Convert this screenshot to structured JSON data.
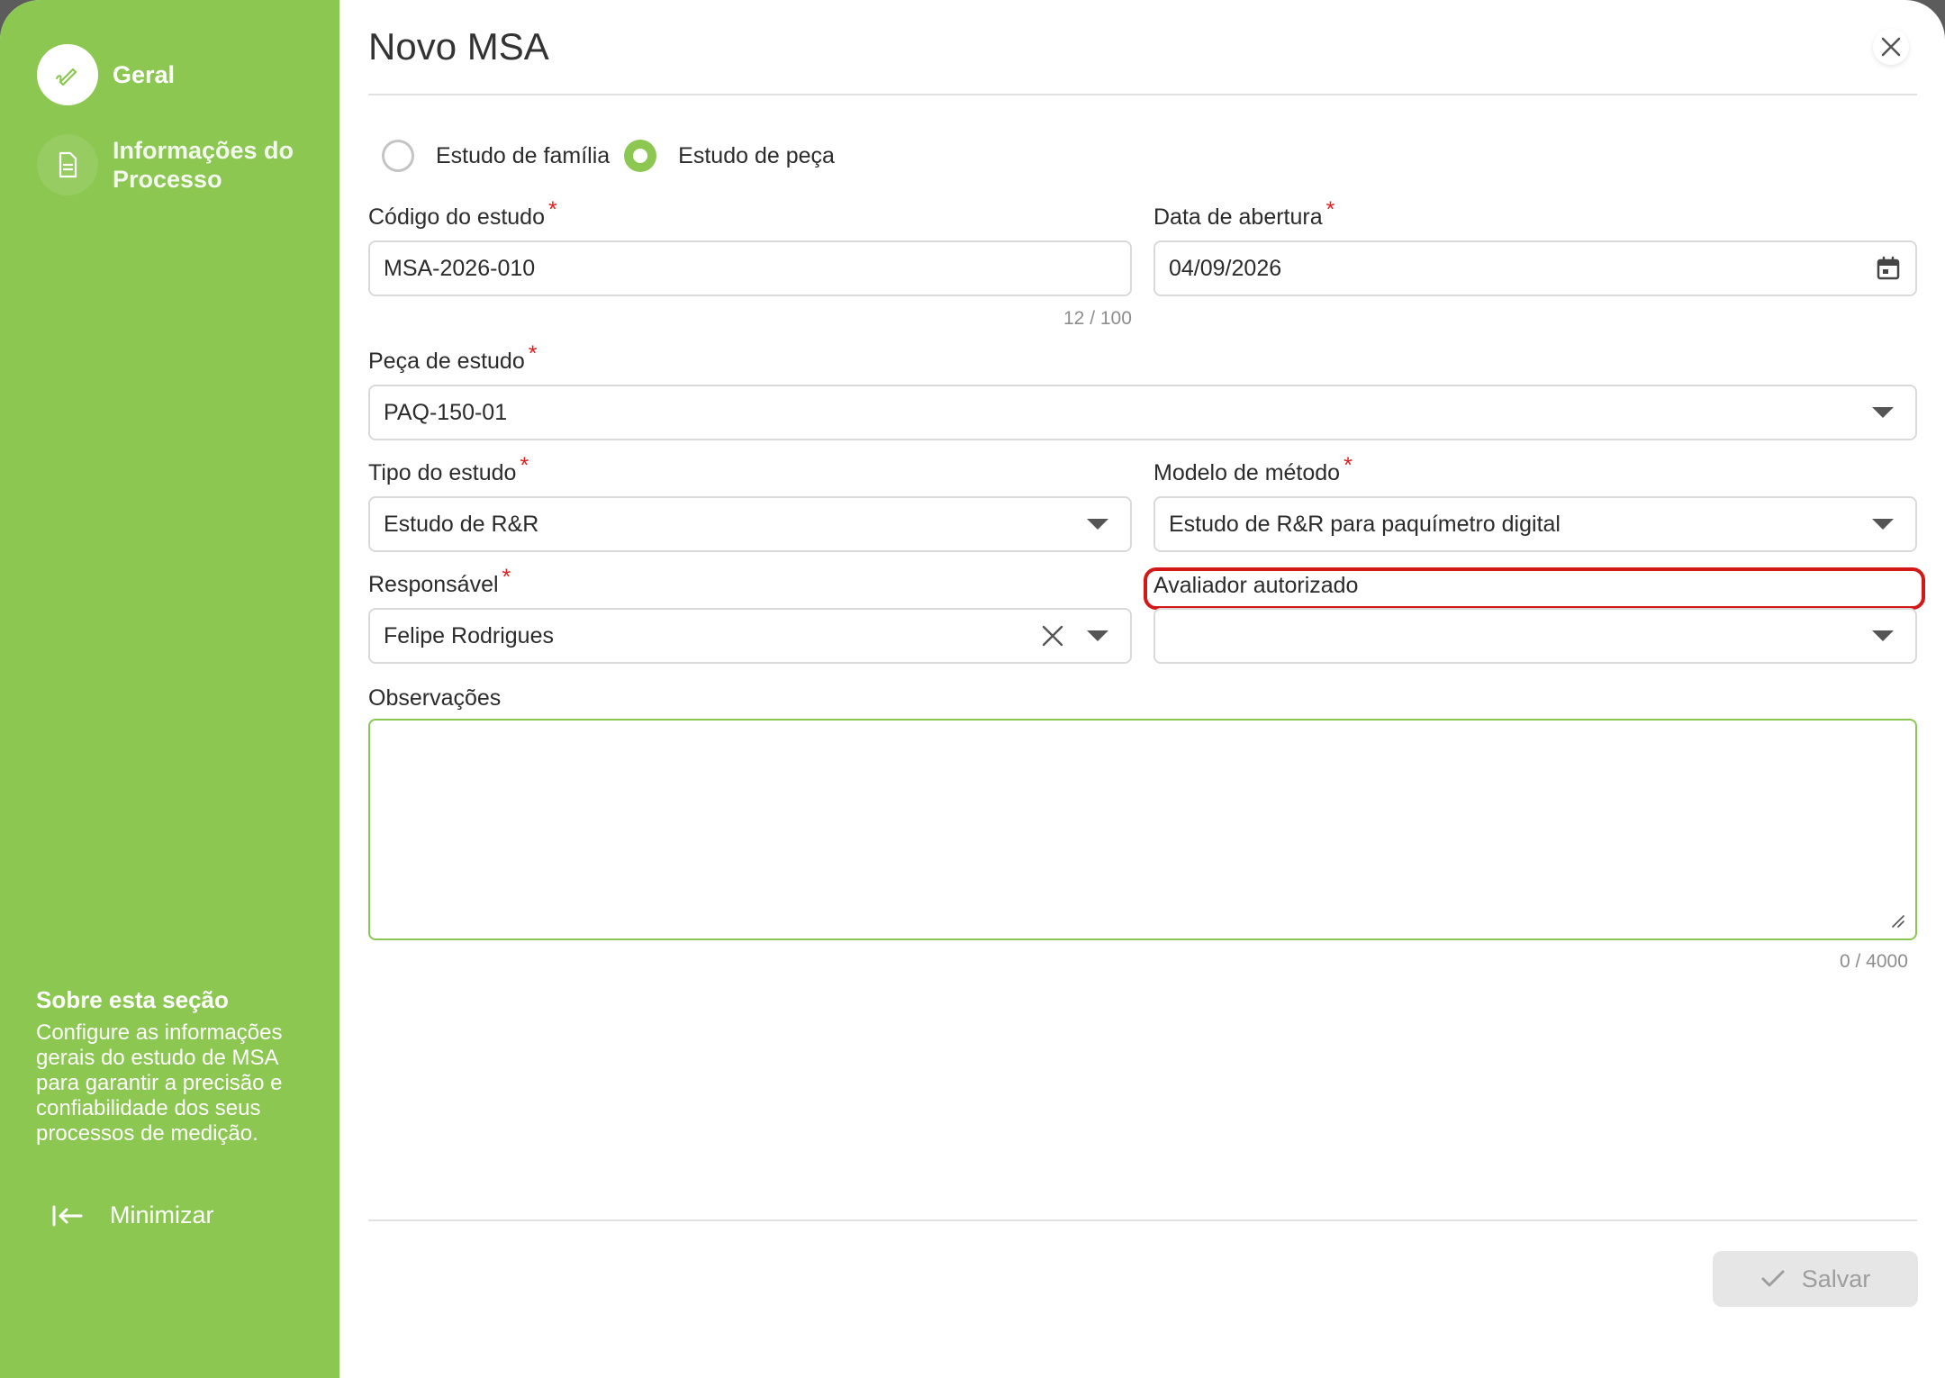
{
  "sidebar": {
    "steps": [
      {
        "label": "Geral",
        "icon": "pencil-icon",
        "active": true
      },
      {
        "label": "Informações do Processo",
        "icon": "document-icon",
        "active": false
      }
    ],
    "about_title": "Sobre esta seção",
    "about_text": "Configure as informações gerais do estudo de MSA para garantir a precisão e confiabilidade dos seus processos de medição.",
    "minimize_label": "Minimizar"
  },
  "header": {
    "title": "Novo MSA"
  },
  "form": {
    "study_kind": {
      "options": [
        "Estudo de família",
        "Estudo de peça"
      ],
      "selected": "Estudo de peça"
    },
    "code": {
      "label": "Código do estudo",
      "value": "MSA-2026-010",
      "counter": "12 / 100",
      "required": "*"
    },
    "opening_date": {
      "label": "Data de abertura",
      "value": "04/09/2026",
      "required": "*"
    },
    "part": {
      "label": "Peça de estudo",
      "value": "PAQ-150-01",
      "required": "*"
    },
    "study_type": {
      "label": "Tipo do estudo",
      "value": "Estudo de R&R",
      "required": "*"
    },
    "method_model": {
      "label": "Modelo de método",
      "value": "Estudo de R&R para paquímetro digital",
      "required": "*"
    },
    "responsible": {
      "label": "Responsável",
      "value": "Felipe Rodrigues",
      "required": "*"
    },
    "evaluator": {
      "label": "Avaliador autorizado",
      "value": ""
    },
    "notes": {
      "label": "Observações",
      "value": "",
      "counter": "0 / 4000"
    }
  },
  "footer": {
    "save_label": "Salvar"
  },
  "colors": {
    "accent": "#8cc751",
    "required": "#e02020",
    "highlight": "#d41818"
  }
}
